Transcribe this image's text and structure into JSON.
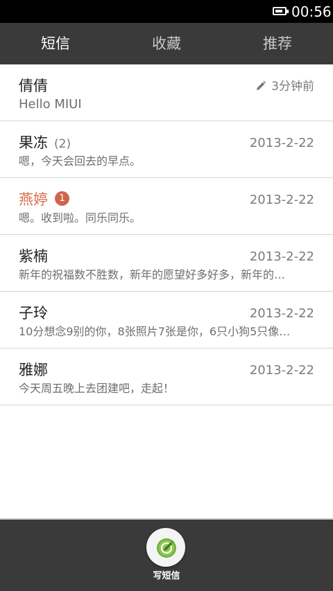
{
  "status_bar": {
    "time": "00:56",
    "battery_level": 0.8
  },
  "tabs": [
    {
      "label": "短信",
      "active": true
    },
    {
      "label": "收藏",
      "active": false
    },
    {
      "label": "推荐",
      "active": false
    }
  ],
  "conversations": [
    {
      "name": "倩倩",
      "count": "",
      "badge": "",
      "date": "",
      "draft_time": "3分钟前",
      "preview": "Hello MIUI",
      "unread": false,
      "draft": true
    },
    {
      "name": "果冻",
      "count": "(2)",
      "badge": "",
      "date": "2013-2-22",
      "draft_time": "",
      "preview": "嗯，今天会回去的早点。",
      "unread": false,
      "draft": false
    },
    {
      "name": "燕婷",
      "count": "",
      "badge": "1",
      "date": "2013-2-22",
      "draft_time": "",
      "preview": "嗯。收到啦。同乐同乐。",
      "unread": true,
      "draft": false
    },
    {
      "name": "紫楠",
      "count": "",
      "badge": "",
      "date": "2013-2-22",
      "draft_time": "",
      "preview": "新年的祝福数不胜数，新年的愿望好多好多，新年的…",
      "unread": false,
      "draft": false
    },
    {
      "name": "子玲",
      "count": "",
      "badge": "",
      "date": "2013-2-22",
      "draft_time": "",
      "preview": "10分想念9别的你，8张照片7张是你，6只小狗5只像…",
      "unread": false,
      "draft": false
    },
    {
      "name": "雅娜",
      "count": "",
      "badge": "",
      "date": "2013-2-22",
      "draft_time": "",
      "preview": "今天周五晚上去团建吧，走起！",
      "unread": false,
      "draft": false
    }
  ],
  "bottom_bar": {
    "compose_label": "写短信",
    "compose_icon": "compose-icon"
  },
  "colors": {
    "bar_background": "#3a3a3a",
    "unread_name": "#d96b4d",
    "badge": "#d0654b",
    "compose_accent": "#6db33f"
  }
}
